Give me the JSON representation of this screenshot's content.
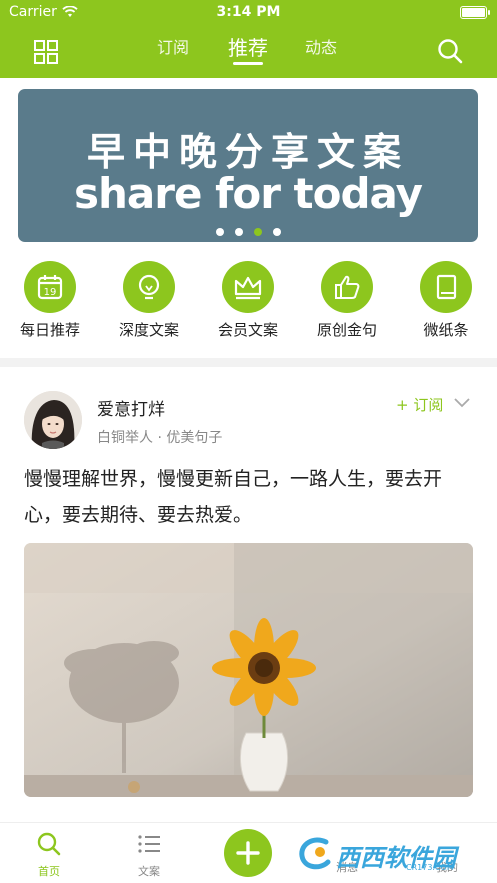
{
  "status_bar": {
    "carrier": "Carrier",
    "time": "3:14 PM"
  },
  "nav": {
    "tabs": [
      {
        "label": "订阅"
      },
      {
        "label": "推荐"
      },
      {
        "label": "动态"
      }
    ],
    "active_tab": "推荐"
  },
  "banner": {
    "title_cn": "早中晚分享文案",
    "title_en": "share for today",
    "active_dot": 3,
    "dot_count": 4
  },
  "quick_links": [
    {
      "label": "每日推荐",
      "icon": "calendar-icon",
      "icon_text": "19"
    },
    {
      "label": "深度文案",
      "icon": "bulb-icon"
    },
    {
      "label": "会员文案",
      "icon": "crown-icon"
    },
    {
      "label": "原创金句",
      "icon": "thumbs-up-icon"
    },
    {
      "label": "微纸条",
      "icon": "book-icon"
    }
  ],
  "post": {
    "author": "爱意打烊",
    "meta": "白铜举人 · 优美句子",
    "subscribe": "+ 订阅",
    "text": "慢慢理解世界，慢慢更新自己，一路人生，要去开心，要去期待、要去热爱。"
  },
  "tabbar": {
    "items": [
      {
        "label": "首页"
      },
      {
        "label": "文案"
      },
      {
        "label": "消息"
      },
      {
        "label": "我的"
      }
    ]
  },
  "watermark": {
    "text": "西西软件园",
    "sub": "CR173.COM"
  },
  "colors": {
    "brand": "#8dc61e",
    "banner_bg": "#5a7b8b"
  }
}
